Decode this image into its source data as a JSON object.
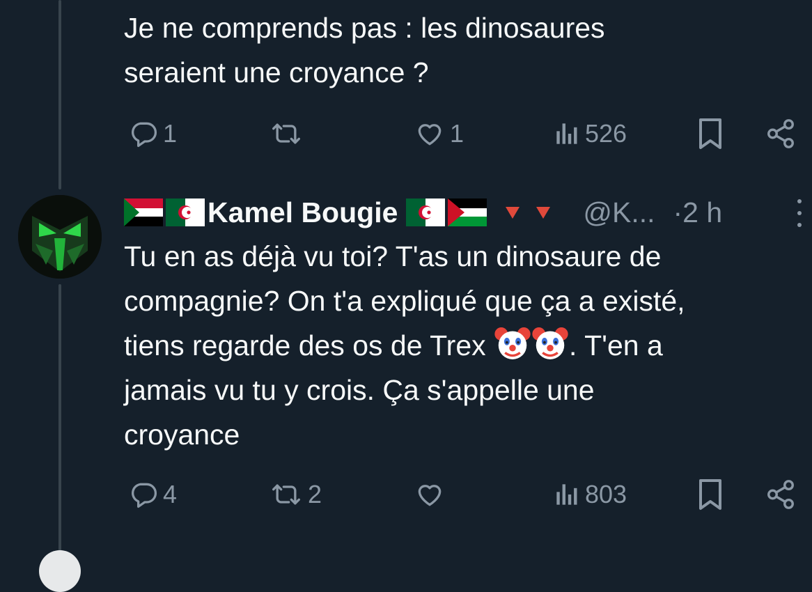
{
  "tweet1": {
    "text": "Je ne comprends pas : les dinosaures\nseraient une croyance ?",
    "replies": "1",
    "retweets": "",
    "likes": "1",
    "views": "526"
  },
  "tweet2": {
    "author_name": "Kamel Bougie",
    "handle": "@K...",
    "time": "·2 h",
    "text_part1": "Tu en as déjà vu toi? T'as un dinosaure de\ncompagnie? On t'a expliqué que ça a existé,\ntiens regarde des os de Trex ",
    "text_part2": ". T'en a\njamais vu tu y crois. Ça s'appelle une\ncroyance",
    "replies": "4",
    "retweets": "2",
    "likes": "",
    "views": "803"
  },
  "icons": {
    "reply": "reply-icon",
    "retweet": "retweet-icon",
    "like": "heart-icon",
    "views": "views-icon",
    "bookmark": "bookmark-icon",
    "share": "share-icon",
    "more": "more-icon",
    "flags": [
      "sudan-flag-icon",
      "algeria-flag-icon",
      "palestine-flag-icon"
    ],
    "red_triangle": "red-triangle-down-icon",
    "clown": "clown-face-icon"
  },
  "colors": {
    "background": "#15202b",
    "text": "#f7f9f9",
    "secondary": "#8b98a5",
    "thread_line": "#38444d"
  }
}
